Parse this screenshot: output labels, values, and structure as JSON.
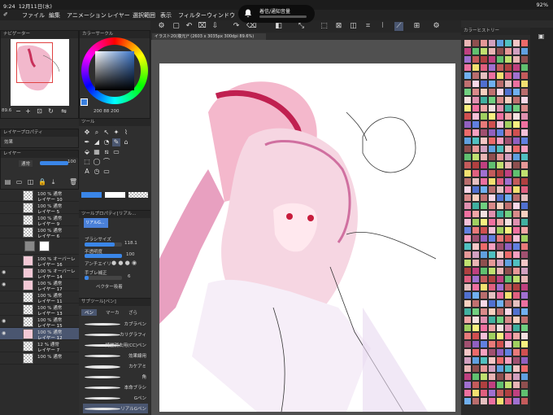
{
  "status": {
    "time": "9:24",
    "date": "12月11日(水)",
    "battery": "92%"
  },
  "notification": {
    "text": "着信/通知音量"
  },
  "menu": [
    "ファイル",
    "編集",
    "アニメーション",
    "レイヤー",
    "選択範囲",
    "表示",
    "フィルター",
    "ウィンドウ"
  ],
  "navigator": {
    "title": "ナビゲーター",
    "zoom": "89.6"
  },
  "color_circle": {
    "title": "カラーサークル",
    "values": "200 88 200"
  },
  "layer_property": {
    "title": "レイヤープロパティ",
    "effect": "効果"
  },
  "layer_panel": {
    "title": "レイヤー",
    "blend": "通常",
    "opacity": "100"
  },
  "tool_panel": {
    "title": "ツール"
  },
  "tool_property": {
    "title": "ツールプロパティ[リアル...",
    "brush_name": "リアルG...",
    "brush_size_label": "ブラシサイズ",
    "brush_size": "118.1",
    "opacity_label": "不透明度",
    "opacity": "100",
    "antialias_label": "アンチエイリ",
    "stabilize_label": "手ブレ補正",
    "stabilize": "6",
    "vector_label": "ベクター吸着"
  },
  "subtool": {
    "title": "サブツール[ペン]",
    "tabs": [
      "ペン",
      "マーカ",
      "ざら"
    ],
    "brushes": [
      "カブラペン",
      "カリグラフィ",
      "綺麗消去用(CC)ペン",
      "効果線用",
      "カケアミ",
      "角",
      "本命ブラシ",
      "Gペン",
      "リアルGペン"
    ]
  },
  "document": {
    "tab": "イラスト20(複元)* (2603 x 3035px 300dpi 89.6%)"
  },
  "layers": [
    {
      "opacity": "100 % 通常",
      "name": "レイヤー 10",
      "visible": false
    },
    {
      "opacity": "100 % 通常",
      "name": "レイヤー 5",
      "visible": false
    },
    {
      "opacity": "100 % 通常",
      "name": "レイヤー 9",
      "visible": false
    },
    {
      "opacity": "100 % 通常",
      "name": "レイヤー 6",
      "visible": false
    },
    {
      "opacity": "100 % 通常",
      "name": "",
      "visible": false
    },
    {
      "opacity": "100 % オーバーレ",
      "name": "レイヤー 16",
      "visible": false
    },
    {
      "opacity": "100 % オーバーレ",
      "name": "レイヤー 14",
      "visible": true
    },
    {
      "opacity": "100 % 通常",
      "name": "レイヤー 17",
      "visible": true
    },
    {
      "opacity": "100 % 通常",
      "name": "レイヤー 11",
      "visible": false
    },
    {
      "opacity": "100 % 通常",
      "name": "レイヤー 13",
      "visible": false
    },
    {
      "opacity": "100 % 通常",
      "name": "レイヤー 15",
      "visible": true
    },
    {
      "opacity": "100 % 通常",
      "name": "レイヤー 12",
      "visible": true
    },
    {
      "opacity": "12 % 通常",
      "name": "レイヤー 7",
      "visible": false
    },
    {
      "opacity": "100 % 通常",
      "name": "",
      "visible": false
    }
  ],
  "color_history": {
    "title": "カラーヒストリー"
  },
  "palette": [
    "#e9b5b5",
    "#d98a8a",
    "#f4c6c6",
    "#b96d6d",
    "#e87a7a",
    "#c45b5b",
    "#f0a6a6",
    "#8f4f4f",
    "#f7d0c0",
    "#ec6a6a",
    "#e5c0c0",
    "#d05050",
    "#b04040",
    "#f4e0e0",
    "#e69898",
    "#c07070",
    "#f6a0c0",
    "#ec70a0",
    "#f4c0d8",
    "#c04080",
    "#e090b0",
    "#d2a0c0",
    "#f8d8e8",
    "#a05070",
    "#f2e070",
    "#a0d060",
    "#60c070",
    "#40b0a0",
    "#60a0e0",
    "#5070d0",
    "#9060c0",
    "#e06080",
    "#f8f080",
    "#c0e070",
    "#70d080",
    "#50c0c0",
    "#70b0f0",
    "#6080e0",
    "#a070d0",
    "#f070a0"
  ]
}
